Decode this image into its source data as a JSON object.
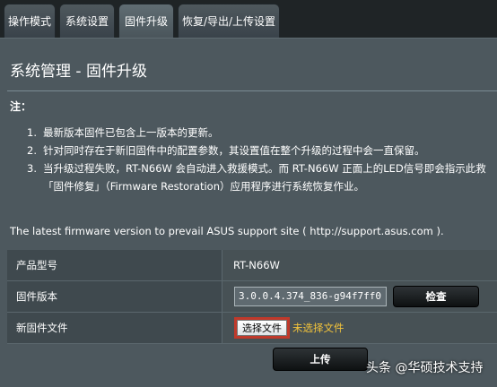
{
  "tabs": [
    {
      "label": "操作模式",
      "active": false
    },
    {
      "label": "系统设置",
      "active": false
    },
    {
      "label": "固件升级",
      "active": true
    },
    {
      "label": "恢复/导出/上传设置",
      "active": false
    }
  ],
  "page": {
    "title": "系统管理 - 固件升级",
    "note_heading": "注：",
    "notes": [
      {
        "num": "1.",
        "text": "最新版本固件已包含上一版本的更新。"
      },
      {
        "num": "2.",
        "text": "针对同时存在于新旧固件中的配置参数，其设置值在整个升级的过程中会一直保留。"
      },
      {
        "num": "3.",
        "text": "当升级过程失败，RT-N66W 会自动进入救援模式。而 RT-N66W 正面上的LED信号即会指示此救"
      },
      {
        "num": "",
        "text": "「固件修复」（Firmware Restoration）应用程序进行系统恢复作业。"
      }
    ],
    "latest_info": "The latest firmware version to prevail ASUS support site ( http://support.asus.com )."
  },
  "table": {
    "model_label": "产品型号",
    "model_value": "RT-N66W",
    "version_label": "固件版本",
    "version_value": "3.0.0.4.374_836-g94f7ff0",
    "check_button": "检查",
    "file_label": "新固件文件",
    "choose_button": "选择文件",
    "no_file_text": "未选择文件",
    "upload_button": "上传"
  },
  "watermark": "头条 @华硕技术支持",
  "colors": {
    "highlight_border": "#c0392b",
    "no_file_text": "#f3c43b"
  }
}
